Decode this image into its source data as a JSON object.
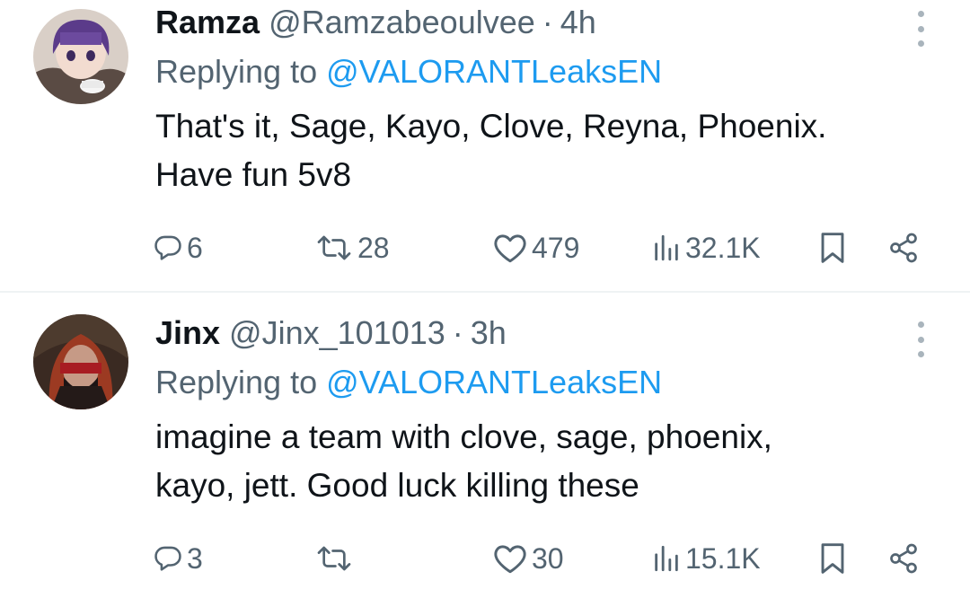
{
  "tweets": [
    {
      "name": "Ramza",
      "handle": "@Ramzabeoulvee",
      "separator": "·",
      "time": "4h",
      "replying_prefix": "Replying to ",
      "replying_to": "@VALORANTLeaksEN",
      "text_line1": "That's it, Sage, Kayo, Clove, Reyna, Phoenix.",
      "text_line2": "Have fun 5v8",
      "replies": "6",
      "retweets": "28",
      "likes": "479",
      "views": "32.1K"
    },
    {
      "name": "Jinx",
      "handle": "@Jinx_101013",
      "separator": "·",
      "time": "3h",
      "replying_prefix": "Replying to ",
      "replying_to": "@VALORANTLeaksEN",
      "text_line1": "imagine a team with clove, sage, phoenix,",
      "text_line2": "kayo, jett. Good luck killing these",
      "replies": "3",
      "retweets": "",
      "likes": "30",
      "views": "15.1K"
    }
  ],
  "icons": {
    "reply": "reply-icon",
    "retweet": "retweet-icon",
    "like": "heart-icon",
    "views": "views-icon",
    "bookmark": "bookmark-icon",
    "share": "share-icon",
    "more": "more-options-icon"
  },
  "colors": {
    "text": "#0f1419",
    "secondary": "#536471",
    "mention": "#1d9bf0",
    "divider": "#eff3f4"
  }
}
